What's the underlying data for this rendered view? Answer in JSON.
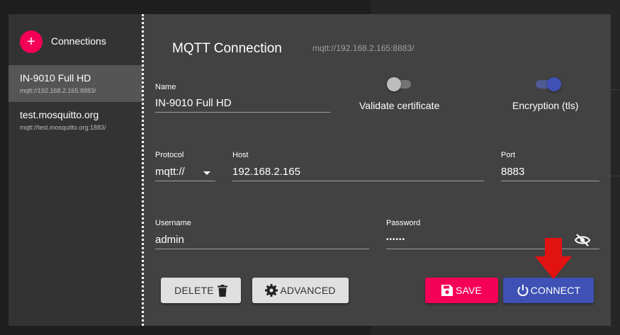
{
  "sidebar": {
    "add_label": "+",
    "title": "Connections",
    "items": [
      {
        "name": "IN-9010 Full HD",
        "url": "mqtt://192.168.2.165:8883/",
        "active": true
      },
      {
        "name": "test.mosquitto.org",
        "url": "mqtt://test.mosquitto.org:1883/",
        "active": false
      }
    ]
  },
  "header": {
    "title": "MQTT Connection",
    "url": "mqtt://192.168.2.165:8883/"
  },
  "form": {
    "name": {
      "label": "Name",
      "value": "IN-9010 Full HD"
    },
    "validate_certificate": {
      "label": "Validate certificate",
      "checked": false
    },
    "encryption": {
      "label": "Encryption (tls)",
      "checked": true
    },
    "protocol": {
      "label": "Protocol",
      "value": "mqtt://"
    },
    "host": {
      "label": "Host",
      "value": "192.168.2.165"
    },
    "port": {
      "label": "Port",
      "value": "8883"
    },
    "username": {
      "label": "Username",
      "value": "admin"
    },
    "password": {
      "label": "Password",
      "value": "••••••"
    }
  },
  "actions": {
    "delete_label": "DELETE",
    "advanced_label": "ADVANCED",
    "save_label": "SAVE",
    "connect_label": "CONNECT"
  },
  "colors": {
    "accent_pink": "#f50057",
    "primary_indigo": "#3f51b5",
    "arrow_red": "#e31212"
  },
  "icons": {
    "delete": "trash-icon",
    "advanced": "gear-icon",
    "save": "floppy-disk-icon",
    "connect": "power-icon",
    "password_toggle": "eye-off-icon",
    "protocol_dropdown": "caret-down-icon",
    "annotation": "red-arrow-down-icon"
  }
}
